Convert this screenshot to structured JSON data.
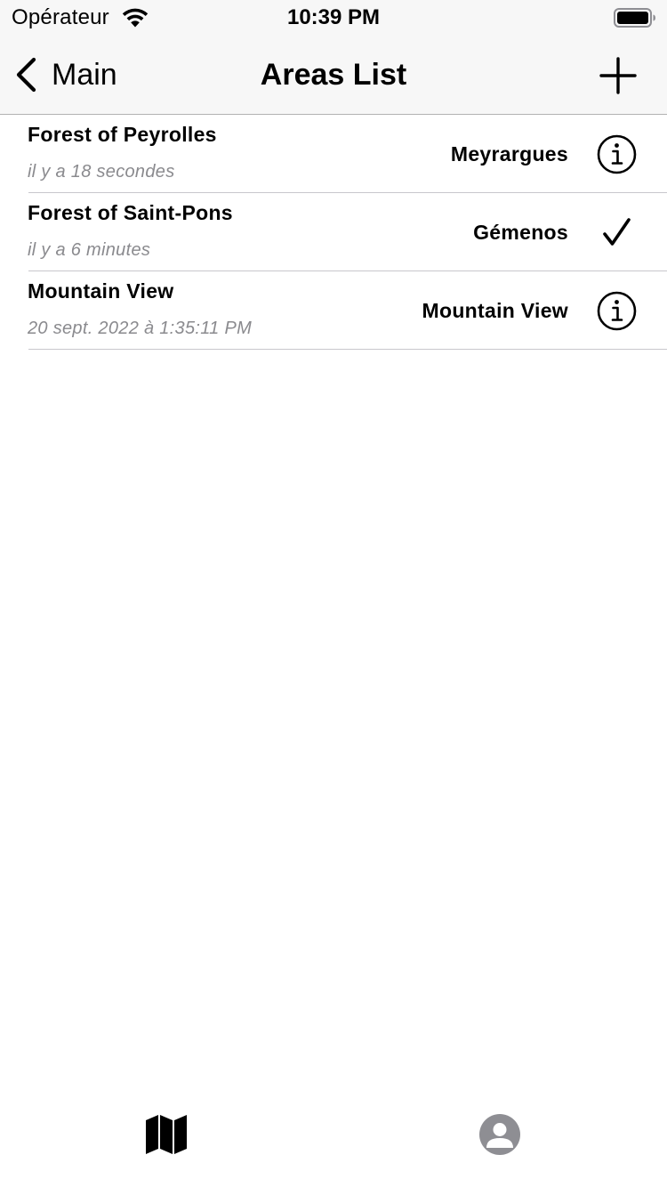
{
  "status_bar": {
    "carrier": "Opérateur",
    "time": "10:39 PM",
    "wifi_icon": "wifi-icon",
    "battery_icon": "battery-full-icon"
  },
  "nav_bar": {
    "back_label": "Main",
    "title": "Areas List",
    "back_icon": "chevron-left-icon",
    "add_icon": "plus-icon"
  },
  "areas": [
    {
      "title": "Forest of Peyrolles",
      "subtitle": "il y a 18 secondes",
      "detail": "Meyrargues",
      "accessory": "info-icon"
    },
    {
      "title": "Forest of Saint-Pons",
      "subtitle": "il y a 6 minutes",
      "detail": "Gémenos",
      "accessory": "checkmark-icon"
    },
    {
      "title": "Mountain View",
      "subtitle": "20 sept. 2022 à 1:35:11 PM",
      "detail": "Mountain View",
      "accessory": "info-icon"
    }
  ],
  "tab_bar": {
    "tabs": [
      {
        "icon": "map-icon",
        "selected": true,
        "color": "#000000"
      },
      {
        "icon": "person-circle-icon",
        "selected": false,
        "color": "#8e8e93"
      }
    ]
  },
  "colors": {
    "bar_background": "#f7f7f7",
    "separator": "#c8c7cc",
    "subtitle_gray": "#8a8a8e",
    "tab_inactive": "#8e8e93"
  }
}
